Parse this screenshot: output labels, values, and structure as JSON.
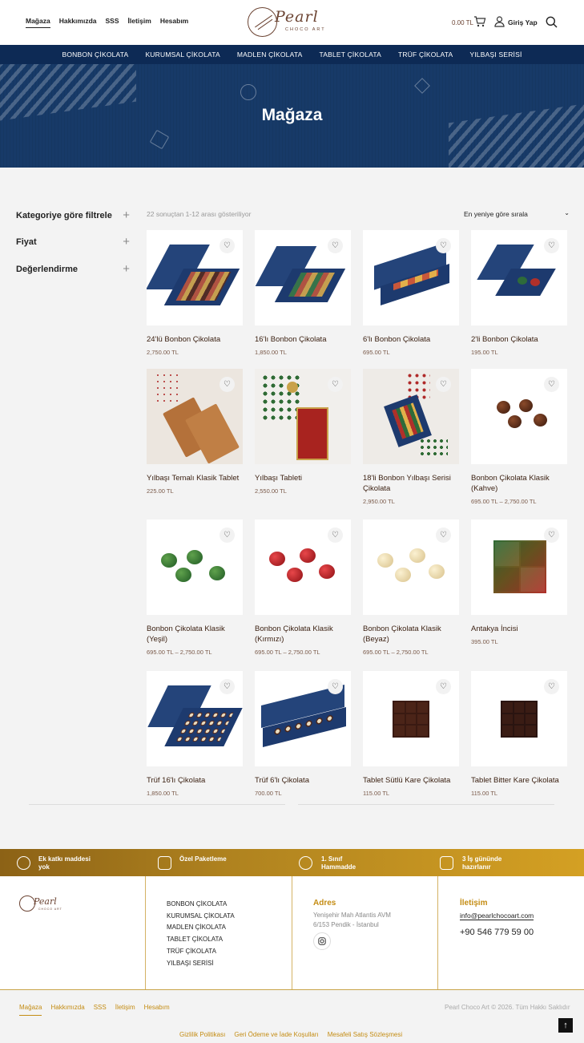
{
  "header": {
    "nav": [
      "Mağaza",
      "Hakkımızda",
      "SSS",
      "İletişim",
      "Hesabım"
    ],
    "logo_name": "Pearl",
    "logo_sub": "CHOCO ART",
    "cart_total": "0.00 TL",
    "login_label": "Giriş Yap"
  },
  "categories": [
    "BONBON ÇİKOLATA",
    "KURUMSAL ÇİKOLATA",
    "MADLEN ÇİKOLATA",
    "TABLET ÇİKOLATA",
    "TRÜF ÇİKOLATA",
    "YILBAŞI SERİSİ"
  ],
  "hero": {
    "title": "Mağaza"
  },
  "filters": [
    "Kategoriye göre filtrele",
    "Fiyat",
    "Değerlendirme"
  ],
  "results_text": "22 sonuçtan 1-12 arası gösteriliyor",
  "sort_label": "En yeniye göre sırala",
  "products": [
    {
      "name": "24'lü Bonbon Çikolata",
      "price": "2,750.00 TL"
    },
    {
      "name": "16'lı Bonbon Çikolata",
      "price": "1,850.00 TL"
    },
    {
      "name": "6'lı Bonbon Çikolata",
      "price": "695.00 TL"
    },
    {
      "name": "2'li Bonbon Çikolata",
      "price": "195.00 TL"
    },
    {
      "name": "Yılbaşı Temalı Klasik Tablet",
      "price": "225.00 TL"
    },
    {
      "name": "Yılbaşı Tableti",
      "price": "2,550.00 TL"
    },
    {
      "name": "18'li Bonbon Yılbaşı Serisi Çikolata",
      "price": "2,950.00 TL"
    },
    {
      "name": "Bonbon Çikolata Klasik (Kahve)",
      "price": "695.00 TL – 2,750.00 TL"
    },
    {
      "name": "Bonbon Çikolata Klasik (Yeşil)",
      "price": "695.00 TL – 2,750.00 TL"
    },
    {
      "name": "Bonbon Çikolata Klasik (Kırmızı)",
      "price": "695.00 TL – 2,750.00 TL"
    },
    {
      "name": "Bonbon Çikolata Klasik (Beyaz)",
      "price": "695.00 TL – 2,750.00 TL"
    },
    {
      "name": "Antakya İncisi",
      "price": "395.00 TL"
    },
    {
      "name": "Trüf 16'lı Çikolata",
      "price": "1,850.00 TL"
    },
    {
      "name": "Trüf 6'lı Çikolata",
      "price": "700.00 TL"
    },
    {
      "name": "Tablet Sütlü Kare Çikolata",
      "price": "115.00 TL"
    },
    {
      "name": "Tablet Bitter Kare Çikolata",
      "price": "115.00 TL"
    }
  ],
  "features": [
    "Ek katkı maddesi yok",
    "Özel Paketleme",
    "1. Sınıf Hammadde",
    "3 İş gününde hazırlanır"
  ],
  "footer": {
    "links": [
      "BONBON ÇİKOLATA",
      "KURUMSAL ÇİKOLATA",
      "MADLEN ÇİKOLATA",
      "TABLET ÇİKOLATA",
      "TRÜF ÇİKOLATA",
      "YILBAŞI SERİSİ"
    ],
    "address_title": "Adres",
    "address_line1": "Yenişehir Mah Atlantis AVM",
    "address_line2": "6/153 Pendik - İstanbul",
    "contact_title": "İletişim",
    "email": "info@pearlchocoart.com",
    "phone": "+90 546 779 59 00",
    "bottom_nav": [
      "Mağaza",
      "Hakkımızda",
      "SSS",
      "İletişim",
      "Hesabım"
    ],
    "copyright": "Pearl Choco Art © 2026. Tüm Hakkı Saklıdır",
    "legal": [
      "Gizlilik Politikası",
      "Geri Ödeme ve İade Koşulları",
      "Mesafeli Satış Sözleşmesi"
    ]
  },
  "colors": {
    "navy": "#0d2a55",
    "gold": "#c48c13",
    "brown": "#6b4332"
  }
}
